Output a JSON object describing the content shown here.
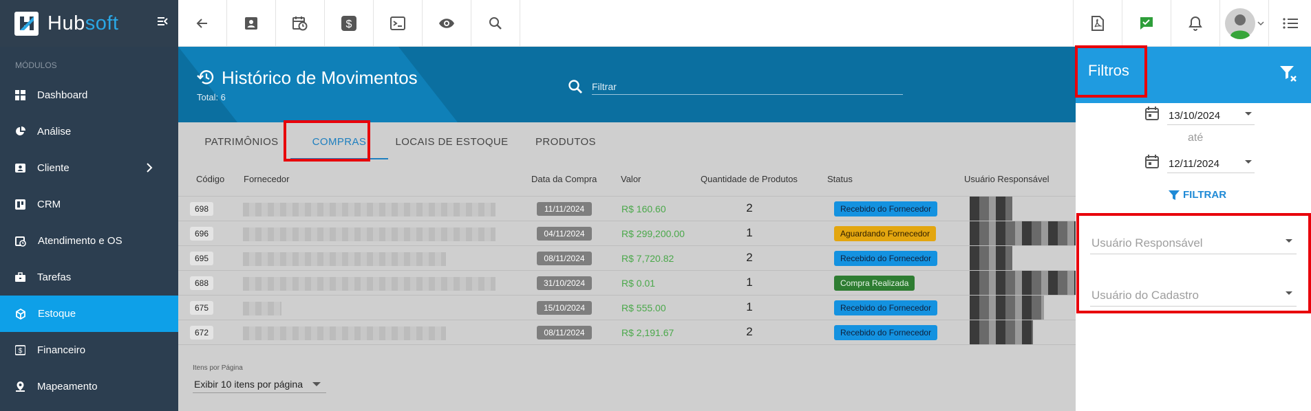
{
  "brand": {
    "part1": "Hub",
    "part2": "soft"
  },
  "sidebar": {
    "section": "MÓDULOS",
    "items": [
      {
        "label": "Dashboard",
        "icon": "dashboard-icon"
      },
      {
        "label": "Análise",
        "icon": "pie-chart-icon"
      },
      {
        "label": "Cliente",
        "icon": "contact-card-icon"
      },
      {
        "label": "CRM",
        "icon": "crm-board-icon"
      },
      {
        "label": "Atendimento e OS",
        "icon": "calendar-clock-icon"
      },
      {
        "label": "Tarefas",
        "icon": "briefcase-icon"
      },
      {
        "label": "Estoque",
        "icon": "cube-icon"
      },
      {
        "label": "Financeiro",
        "icon": "dollar-icon"
      },
      {
        "label": "Mapeamento",
        "icon": "map-pin-icon"
      }
    ]
  },
  "header": {
    "title": "Histórico de Movimentos",
    "total": "Total: 6",
    "filter_placeholder": "Filtrar"
  },
  "tabs": [
    "PATRIMÔNIOS",
    "COMPRAS",
    "LOCAIS DE ESTOQUE",
    "PRODUTOS"
  ],
  "table": {
    "columns": [
      "Código",
      "Fornecedor",
      "Data da Compra",
      "Valor",
      "Quantidade de Produtos",
      "Status",
      "Usuário Responsável"
    ],
    "rows": [
      {
        "code": "698",
        "date": "11/11/2024",
        "value": "R$ 160.60",
        "qty": "2",
        "status": "Recebido do Fornecedor"
      },
      {
        "code": "696",
        "date": "04/11/2024",
        "value": "R$ 299,200.00",
        "qty": "1",
        "status": "Aguardando Fornecedor"
      },
      {
        "code": "695",
        "date": "08/11/2024",
        "value": "R$ 7,720.82",
        "qty": "2",
        "status": "Recebido do Fornecedor"
      },
      {
        "code": "688",
        "date": "31/10/2024",
        "value": "R$ 0.01",
        "qty": "1",
        "status": "Compra Realizada"
      },
      {
        "code": "675",
        "date": "15/10/2024",
        "value": "R$ 555.00",
        "qty": "1",
        "status": "Recebido do Fornecedor"
      },
      {
        "code": "672",
        "date": "08/11/2024",
        "value": "R$ 2,191.67",
        "qty": "2",
        "status": "Recebido do Fornecedor"
      }
    ]
  },
  "pagination": {
    "label": "Itens por Página",
    "selected": "Exibir 10 itens por página"
  },
  "filters": {
    "title": "Filtros",
    "date_from": "13/10/2024",
    "between": "até",
    "date_to": "12/11/2024",
    "apply": "FILTRAR",
    "responsible_placeholder": "Usuário Responsável",
    "register_placeholder": "Usuário do Cadastro"
  },
  "colors": {
    "sidebar": "#2c3e50",
    "active": "#0ea0e8",
    "header": "#0b6fa0",
    "panel_head": "#1f9be0",
    "highlight": "#e8000a"
  }
}
